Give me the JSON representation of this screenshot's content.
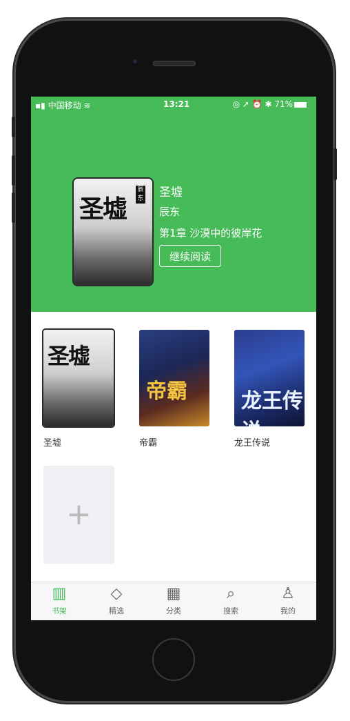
{
  "status_bar": {
    "carrier": "中国移动",
    "time": "13:21",
    "battery": "71%"
  },
  "hero": {
    "cover_text": "圣墟",
    "cover_tag": "辰东",
    "title": "圣墟",
    "author": "辰东",
    "chapter": "第1章 沙漠中的彼岸花",
    "continue_label": "继续阅读"
  },
  "books": [
    {
      "name": "圣墟",
      "cover_text": "圣墟"
    },
    {
      "name": "帝霸",
      "cover_text": "帝霸"
    },
    {
      "name": "龙王传说",
      "cover_text": "龙王传说"
    }
  ],
  "add_card": {
    "symbol": "+"
  },
  "tabbar": {
    "items": [
      {
        "label": "书架",
        "icon": "bookshelf-icon",
        "active": true
      },
      {
        "label": "精选",
        "icon": "diamond-icon",
        "active": false
      },
      {
        "label": "分类",
        "icon": "grid-icon",
        "active": false
      },
      {
        "label": "搜索",
        "icon": "search-icon",
        "active": false
      },
      {
        "label": "我的",
        "icon": "person-icon",
        "active": false
      }
    ]
  },
  "colors": {
    "accent": "#46bb58",
    "tab_inactive": "#666666"
  }
}
